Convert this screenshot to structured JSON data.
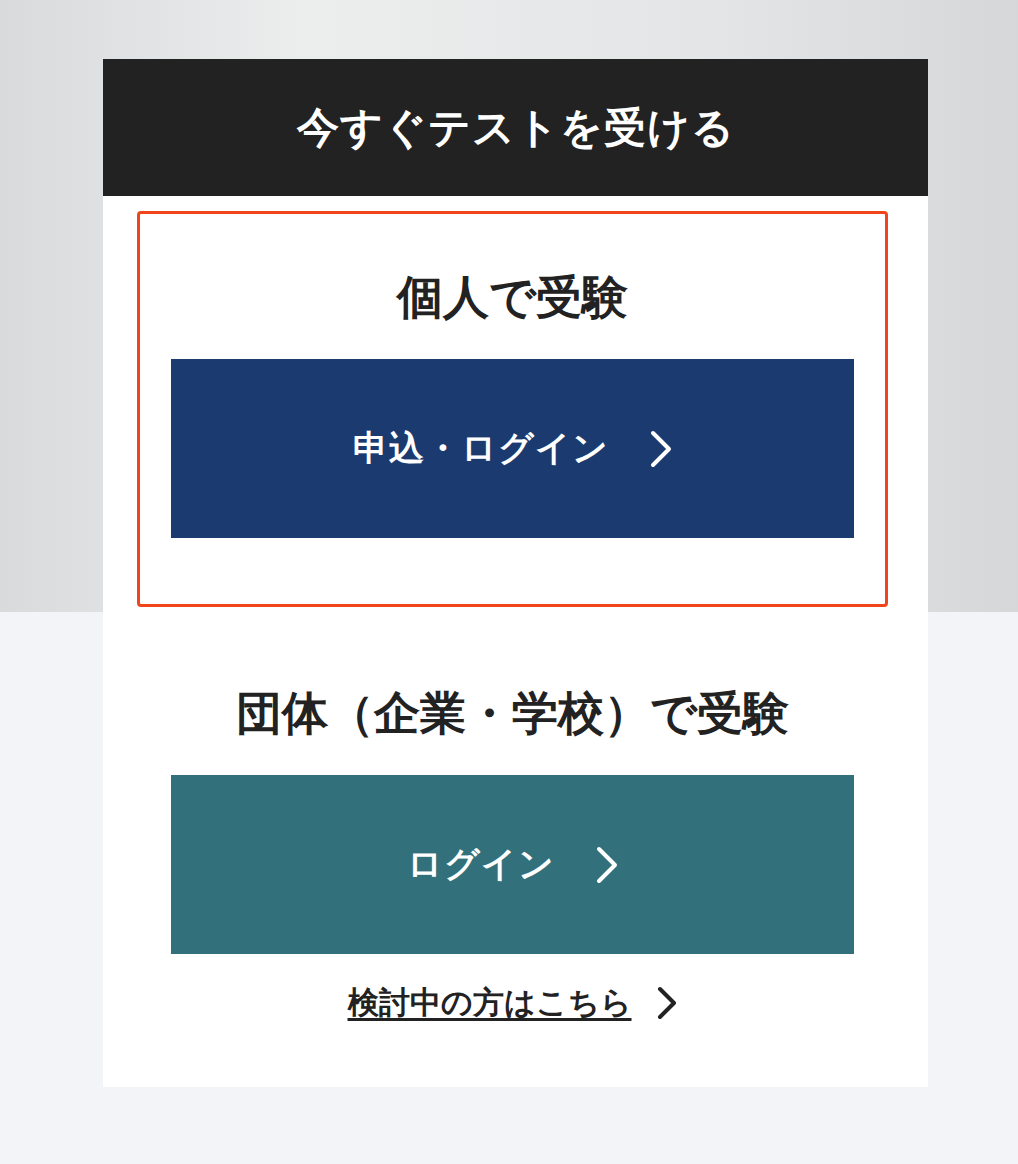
{
  "header": {
    "title": "今すぐテストを受ける"
  },
  "sections": [
    {
      "title": "個人で受験",
      "highlighted": true,
      "button": {
        "label": "申込・ログイン",
        "color": "#1b3a70"
      },
      "link": null
    },
    {
      "title": "団体（企業・学校）で受験",
      "highlighted": false,
      "button": {
        "label": "ログイン",
        "color": "#32707c"
      },
      "link": "検討中の方はこちら"
    }
  ]
}
